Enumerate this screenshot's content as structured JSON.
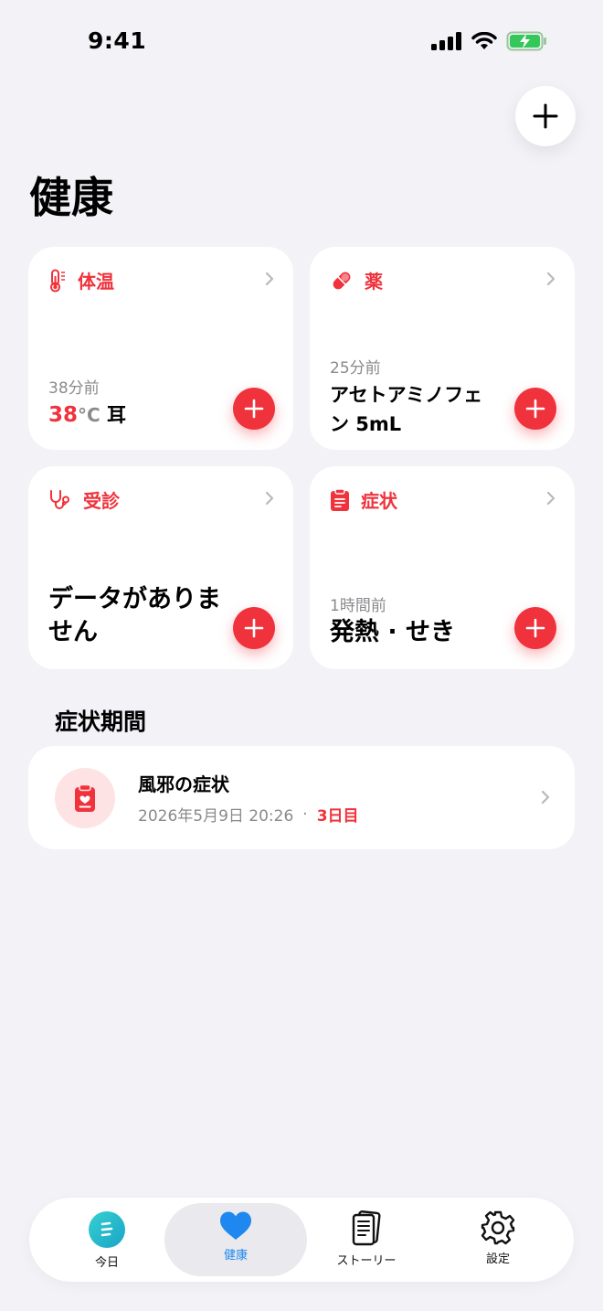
{
  "status_bar": {
    "time": "9:41"
  },
  "page": {
    "title": "健康"
  },
  "cards": {
    "temperature": {
      "title": "体温",
      "sub": "38分前",
      "value": "38",
      "unit": "°C",
      "site": "耳"
    },
    "medicine": {
      "title": "薬",
      "sub": "25分前",
      "main": "アセトアミノフェン 5mL"
    },
    "visit": {
      "title": "受診",
      "main": "データがありません"
    },
    "symptoms": {
      "title": "症状",
      "sub": "1時間前",
      "main": "発熱 · せき"
    }
  },
  "periods": {
    "title": "症状期間",
    "item": {
      "title": "風邪の症状",
      "date": "2026年5月9日 20:26",
      "dot": "·",
      "day": "3日目"
    }
  },
  "tabbar": {
    "today": "今日",
    "health": "健康",
    "story": "ストーリー",
    "settings": "設定"
  },
  "colors": {
    "accent": "#F0323C",
    "tab_active": "#1E88F0",
    "background": "#F2F2F7"
  }
}
